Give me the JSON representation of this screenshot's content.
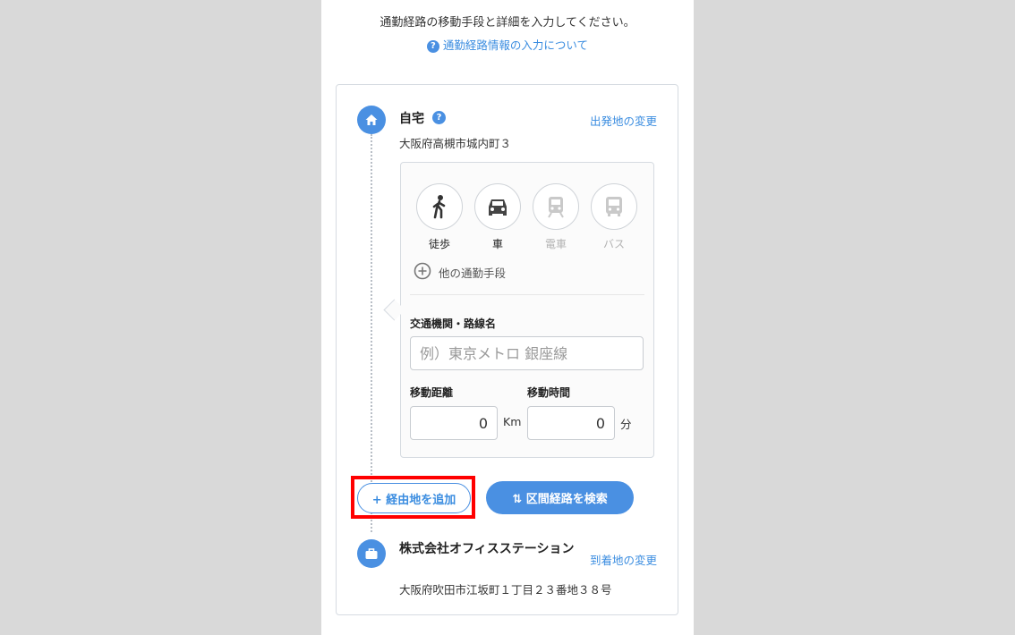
{
  "intro": {
    "text": "通勤経路の移動手段と詳細を入力してください。",
    "help_link": "通勤経路情報の入力について",
    "help_icon": "question-icon"
  },
  "origin": {
    "icon": "home-icon",
    "title": "自宅",
    "help_icon": "question-icon",
    "address": "大阪府高槻市城内町３",
    "change_link": "出発地の変更"
  },
  "modes": [
    {
      "label": "徒歩",
      "icon": "walk-icon",
      "enabled": true
    },
    {
      "label": "車",
      "icon": "car-icon",
      "enabled": true
    },
    {
      "label": "電車",
      "icon": "train-icon",
      "enabled": false
    },
    {
      "label": "バス",
      "icon": "bus-icon",
      "enabled": false
    }
  ],
  "other_modes": "他の通勤手段",
  "route": {
    "label": "交通機関・路線名",
    "placeholder": "例）東京メトロ 銀座線"
  },
  "distance": {
    "label": "移動距離",
    "value": "0",
    "unit": "Km"
  },
  "time": {
    "label": "移動時間",
    "value": "0",
    "unit": "分"
  },
  "buttons": {
    "add_waypoint": "+ 経由地を追加",
    "search_route": "⇅ 区間経路を検索"
  },
  "destination": {
    "icon": "briefcase-icon",
    "title": "株式会社オフィスステーション",
    "address": "大阪府吹田市江坂町１丁目２３番地３８号",
    "change_link": "到着地の変更"
  },
  "colors": {
    "accent": "#4a90e2",
    "link": "#3b8de0",
    "highlight": "#ff0000",
    "background": "#d9d9d9"
  }
}
